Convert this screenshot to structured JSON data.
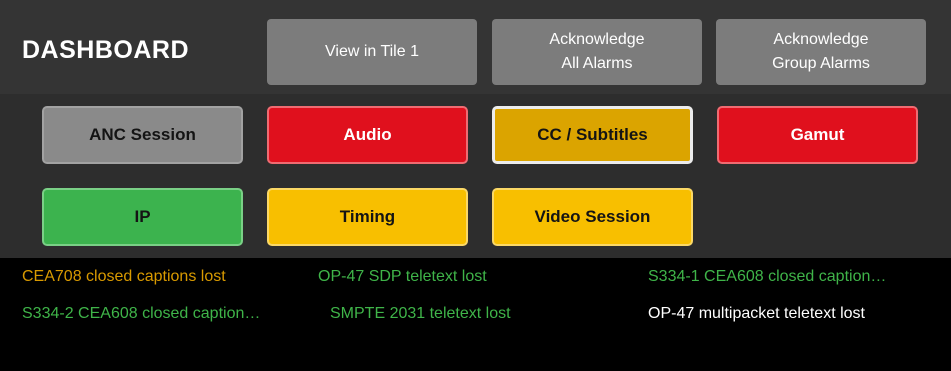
{
  "header": {
    "title": "DASHBOARD",
    "view_tile_button": "View in Tile 1",
    "ack_all_line1": "Acknowledge",
    "ack_all_line2": "All Alarms",
    "ack_group_line1": "Acknowledge",
    "ack_group_line2": "Group Alarms"
  },
  "tiles": [
    {
      "label": "ANC Session",
      "status": "gray"
    },
    {
      "label": "Audio",
      "status": "red"
    },
    {
      "label": "CC / Subtitles",
      "status": "gold",
      "selected": true
    },
    {
      "label": "Gamut",
      "status": "red"
    },
    {
      "label": "IP",
      "status": "green"
    },
    {
      "label": "Timing",
      "status": "yellow"
    },
    {
      "label": "Video Session",
      "status": "yellow"
    }
  ],
  "messages": [
    {
      "text": "CEA708 closed captions lost",
      "color": "#d99a00"
    },
    {
      "text": "OP-47 SDP teletext lost",
      "color": "#3fb449"
    },
    {
      "text": "S334-1 CEA608 closed caption…",
      "color": "#3fb449"
    },
    {
      "text": "S334-2 CEA608 closed caption…",
      "color": "#3fb449"
    },
    {
      "text": "SMPTE 2031 teletext lost",
      "color": "#3fb449"
    },
    {
      "text": "OP-47 multipacket teletext lost",
      "color": "#ffffff"
    }
  ],
  "colors": {
    "header_bg": "#343434",
    "panel_bg": "#2d2d2d",
    "log_bg": "#000000",
    "alarm_red": "#e0101d",
    "warning_yellow": "#f8bf00",
    "ok_green": "#3cb34e",
    "inactive_gray": "#8a8a8a"
  }
}
